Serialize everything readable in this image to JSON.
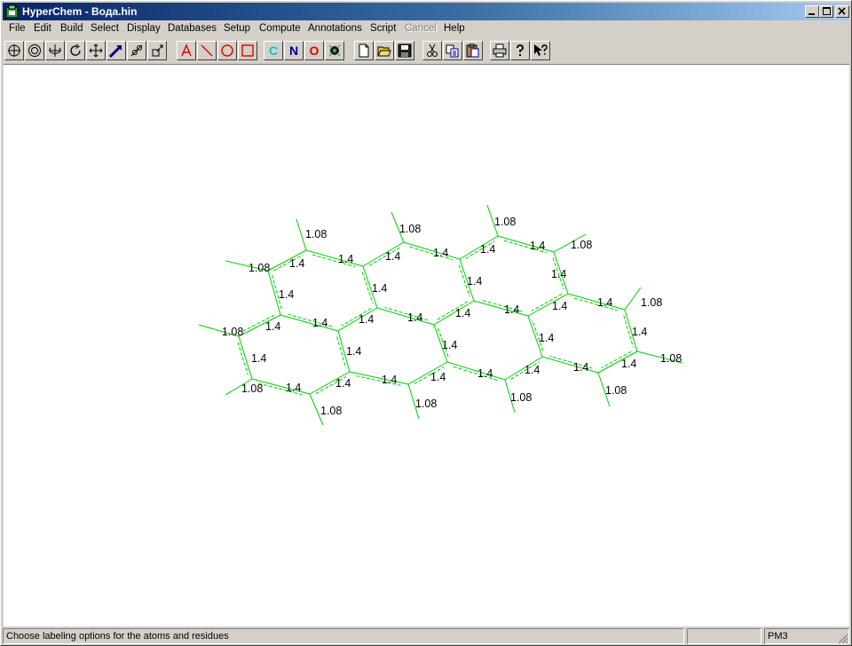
{
  "app": {
    "title": "HyperChem - Вода.hin"
  },
  "menu": [
    {
      "label": "File"
    },
    {
      "label": "Edit"
    },
    {
      "label": "Build"
    },
    {
      "label": "Select"
    },
    {
      "label": "Display"
    },
    {
      "label": "Databases"
    },
    {
      "label": "Setup"
    },
    {
      "label": "Compute"
    },
    {
      "label": "Annotations"
    },
    {
      "label": "Script"
    },
    {
      "label": "Cancel",
      "disabled": true
    },
    {
      "label": "Help"
    }
  ],
  "toolbar": {
    "tools": [
      "draw-icon",
      "select-icon",
      "rotate-out-of-plane-icon",
      "rotate-in-plane-icon",
      "translate-icon",
      "magnify-icon",
      "z-translate-icon",
      "z-clip-icon"
    ],
    "annotation_tools": [
      "text-annotation-icon",
      "line-annotation-icon",
      "ellipse-annotation-icon",
      "rectangle-annotation-icon"
    ],
    "element_labels": {
      "carbon": "C",
      "nitrogen": "N",
      "oxygen": "O"
    },
    "element_colors": {
      "carbon": "#00c8c8",
      "nitrogen": "#00008b",
      "oxygen": "#e00000"
    },
    "file_tools": [
      "new-file-icon",
      "open-file-icon",
      "save-file-icon"
    ],
    "edit_tools": [
      "cut-icon",
      "copy-icon",
      "paste-icon"
    ],
    "misc_tools": [
      "print-icon",
      "help-icon",
      "context-help-icon"
    ]
  },
  "molecule": {
    "bond_color": "#00cc00",
    "bond_labels": {
      "cc": "1.4",
      "ch": "1.08"
    }
  },
  "status": {
    "message": "Choose labeling options for the atoms and residues",
    "method": "PM3"
  }
}
